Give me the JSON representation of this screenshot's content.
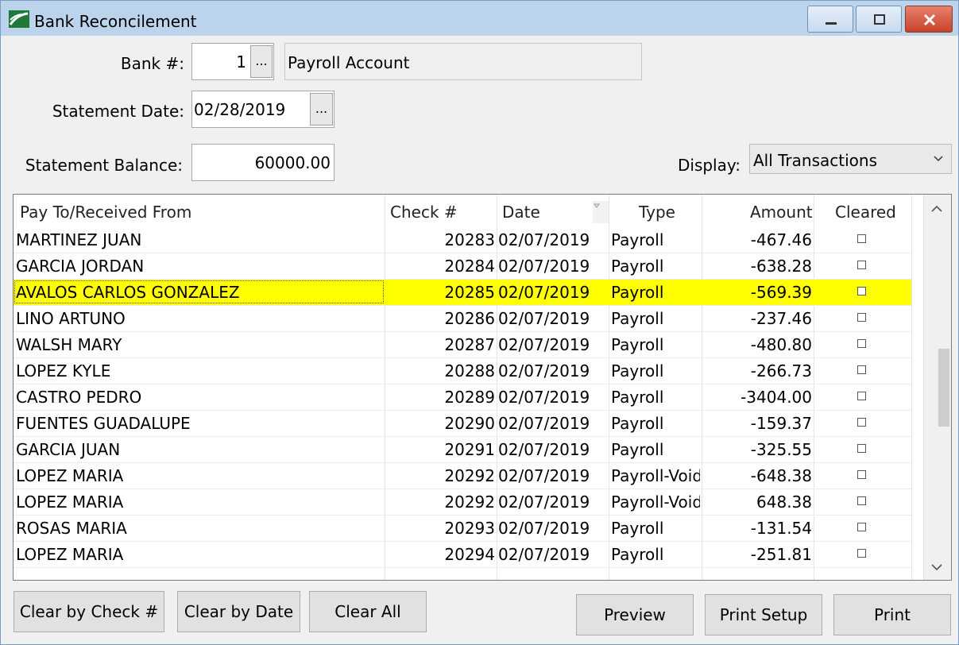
{
  "window": {
    "title": "Bank Reconcilement"
  },
  "form": {
    "bank_label": "Bank #:",
    "bank_value": "1",
    "bank_lookup": "...",
    "bank_name": "Payroll Account",
    "statement_date_label": "Statement Date:",
    "statement_date_value": "02/28/2019",
    "date_lookup": "...",
    "statement_balance_label": "Statement Balance:",
    "statement_balance_value": "60000.00",
    "display_label": "Display:",
    "display_value": "All Transactions"
  },
  "grid": {
    "columns": [
      "Pay To/Received From",
      "Check #",
      "Date",
      "Type",
      "Amount",
      "Cleared"
    ],
    "rows": [
      {
        "name": "MARTINEZ JUAN",
        "check": "20283",
        "date": "02/07/2019",
        "type": "Payroll",
        "amount": "-467.46",
        "cleared": false,
        "selected": false
      },
      {
        "name": "GARCIA JORDAN",
        "check": "20284",
        "date": "02/07/2019",
        "type": "Payroll",
        "amount": "-638.28",
        "cleared": false,
        "selected": false
      },
      {
        "name": "AVALOS CARLOS GONZALEZ",
        "check": "20285",
        "date": "02/07/2019",
        "type": "Payroll",
        "amount": "-569.39",
        "cleared": false,
        "selected": true
      },
      {
        "name": "LINO ARTUNO",
        "check": "20286",
        "date": "02/07/2019",
        "type": "Payroll",
        "amount": "-237.46",
        "cleared": false,
        "selected": false
      },
      {
        "name": "WALSH MARY",
        "check": "20287",
        "date": "02/07/2019",
        "type": "Payroll",
        "amount": "-480.80",
        "cleared": false,
        "selected": false
      },
      {
        "name": "LOPEZ KYLE",
        "check": "20288",
        "date": "02/07/2019",
        "type": "Payroll",
        "amount": "-266.73",
        "cleared": false,
        "selected": false
      },
      {
        "name": "CASTRO PEDRO",
        "check": "20289",
        "date": "02/07/2019",
        "type": "Payroll",
        "amount": "-3404.00",
        "cleared": false,
        "selected": false
      },
      {
        "name": "FUENTES GUADALUPE",
        "check": "20290",
        "date": "02/07/2019",
        "type": "Payroll",
        "amount": "-159.37",
        "cleared": false,
        "selected": false
      },
      {
        "name": "GARCIA JUAN",
        "check": "20291",
        "date": "02/07/2019",
        "type": "Payroll",
        "amount": "-325.55",
        "cleared": false,
        "selected": false
      },
      {
        "name": "LOPEZ MARIA",
        "check": "20292",
        "date": "02/07/2019",
        "type": "Payroll-Voided",
        "amount": "-648.38",
        "cleared": false,
        "selected": false
      },
      {
        "name": "LOPEZ MARIA",
        "check": "20292",
        "date": "02/07/2019",
        "type": "Payroll-Voided",
        "amount": "648.38",
        "cleared": false,
        "selected": false
      },
      {
        "name": "ROSAS MARIA",
        "check": "20293",
        "date": "02/07/2019",
        "type": "Payroll",
        "amount": "-131.54",
        "cleared": false,
        "selected": false
      },
      {
        "name": "LOPEZ MARIA",
        "check": "20294",
        "date": "02/07/2019",
        "type": "Payroll",
        "amount": "-251.81",
        "cleared": false,
        "selected": false
      }
    ]
  },
  "buttons": {
    "clear_by_check": "Clear by Check #",
    "clear_by_date": "Clear by Date",
    "clear_all": "Clear All",
    "preview": "Preview",
    "print_setup": "Print Setup",
    "print": "Print"
  },
  "colors": {
    "selection": "#ffff00",
    "titlebar": "#bcd3ec",
    "close_button": "#c7432b"
  }
}
